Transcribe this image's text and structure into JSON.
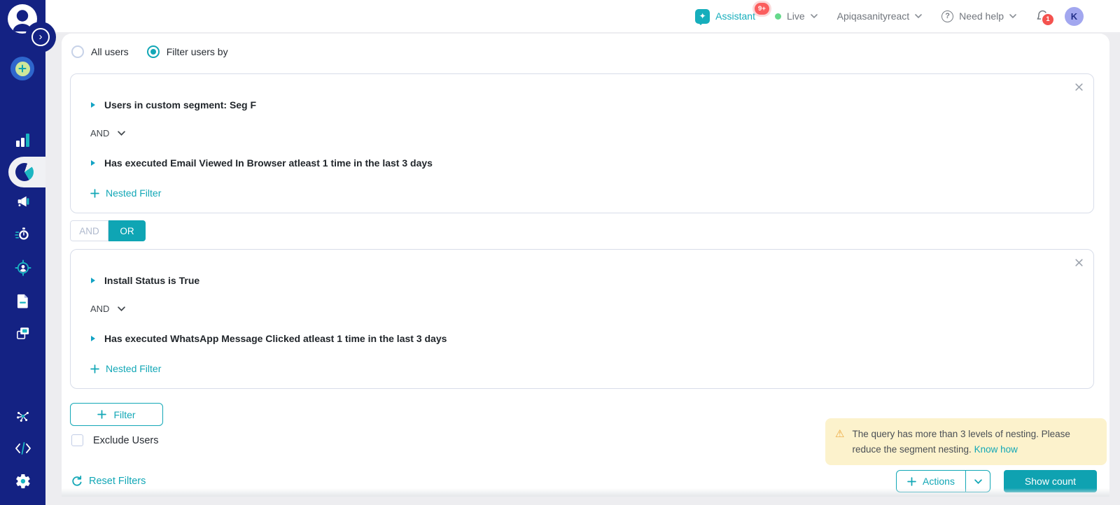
{
  "header": {
    "assistant": {
      "label": "Assistant",
      "badge": "9+"
    },
    "environment": {
      "label": "Live"
    },
    "workspace": {
      "label": "Apiqasanityreact"
    },
    "help": {
      "label": "Need help"
    },
    "notifications": {
      "badge": "1"
    },
    "avatar": {
      "initial": "K"
    }
  },
  "sidebar": {
    "icons": [
      "moengage-logo",
      "expand-sidebar",
      "create-new",
      "dashboard",
      "analytics",
      "segments",
      "campaigns",
      "journeys",
      "audience",
      "content",
      "templates",
      "connectors",
      "developer-api",
      "settings"
    ],
    "active_item": "segments"
  },
  "segmentation": {
    "user_scope": {
      "all_users_label": "All users",
      "filter_users_label": "Filter users by",
      "selected": "Filter users by"
    },
    "group1": {
      "condition1": "Users in custom segment: Seg F",
      "operator": "AND",
      "condition2": "Has executed Email Viewed In Browser atleast 1 time in the last 3 days",
      "nested_filter_label": "Nested Filter"
    },
    "connector": {
      "and_label": "AND",
      "or_label": "OR",
      "selected": "OR"
    },
    "group2": {
      "condition1": "Install Status is True",
      "operator": "AND",
      "condition2": "Has executed WhatsApp Message Clicked atleast 1 time in the last 3 days",
      "nested_filter_label": "Nested Filter"
    },
    "filter_button_label": "Filter",
    "exclude_users_label": "Exclude Users",
    "reset_filters_label": "Reset Filters"
  },
  "toast": {
    "message": "The query has more than 3 levels of nesting. Please reduce the segment nesting.",
    "link_label": "Know how"
  },
  "footer": {
    "actions_label": "Actions",
    "show_count_label": "Show count"
  },
  "colors": {
    "sidebar_navy": "#142283",
    "accent_teal": "#12a7b6",
    "toast_background": "#fcf2cc",
    "warning_orange": "#eda73c",
    "badge_red": "#fb5e5e",
    "avatar_purple": "#a2a7ef",
    "live_green": "#66d98b"
  }
}
